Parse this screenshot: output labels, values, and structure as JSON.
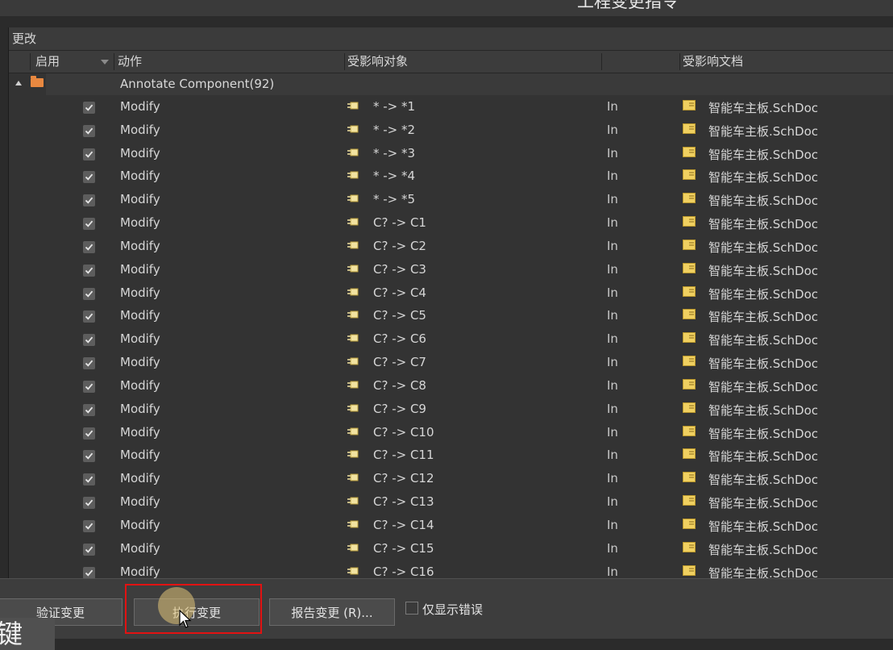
{
  "window": {
    "title": "工程变更指令"
  },
  "changes_panel": {
    "group_header": "更改",
    "columns": {
      "enable": "启用",
      "action": "动作",
      "affected_object": "受影响对象",
      "affected_document": "受影响文档"
    },
    "group": {
      "label": "Annotate Component(92)",
      "expanded": true
    },
    "rows": [
      {
        "enabled": true,
        "action": "Modify",
        "object": "* -> *1",
        "direction": "In",
        "document": "智能车主板.SchDoc"
      },
      {
        "enabled": true,
        "action": "Modify",
        "object": "* -> *2",
        "direction": "In",
        "document": "智能车主板.SchDoc"
      },
      {
        "enabled": true,
        "action": "Modify",
        "object": "* -> *3",
        "direction": "In",
        "document": "智能车主板.SchDoc"
      },
      {
        "enabled": true,
        "action": "Modify",
        "object": "* -> *4",
        "direction": "In",
        "document": "智能车主板.SchDoc"
      },
      {
        "enabled": true,
        "action": "Modify",
        "object": "* -> *5",
        "direction": "In",
        "document": "智能车主板.SchDoc"
      },
      {
        "enabled": true,
        "action": "Modify",
        "object": "C? -> C1",
        "direction": "In",
        "document": "智能车主板.SchDoc"
      },
      {
        "enabled": true,
        "action": "Modify",
        "object": "C? -> C2",
        "direction": "In",
        "document": "智能车主板.SchDoc"
      },
      {
        "enabled": true,
        "action": "Modify",
        "object": "C? -> C3",
        "direction": "In",
        "document": "智能车主板.SchDoc"
      },
      {
        "enabled": true,
        "action": "Modify",
        "object": "C? -> C4",
        "direction": "In",
        "document": "智能车主板.SchDoc"
      },
      {
        "enabled": true,
        "action": "Modify",
        "object": "C? -> C5",
        "direction": "In",
        "document": "智能车主板.SchDoc"
      },
      {
        "enabled": true,
        "action": "Modify",
        "object": "C? -> C6",
        "direction": "In",
        "document": "智能车主板.SchDoc"
      },
      {
        "enabled": true,
        "action": "Modify",
        "object": "C? -> C7",
        "direction": "In",
        "document": "智能车主板.SchDoc"
      },
      {
        "enabled": true,
        "action": "Modify",
        "object": "C? -> C8",
        "direction": "In",
        "document": "智能车主板.SchDoc"
      },
      {
        "enabled": true,
        "action": "Modify",
        "object": "C? -> C9",
        "direction": "In",
        "document": "智能车主板.SchDoc"
      },
      {
        "enabled": true,
        "action": "Modify",
        "object": "C? -> C10",
        "direction": "In",
        "document": "智能车主板.SchDoc"
      },
      {
        "enabled": true,
        "action": "Modify",
        "object": "C? -> C11",
        "direction": "In",
        "document": "智能车主板.SchDoc"
      },
      {
        "enabled": true,
        "action": "Modify",
        "object": "C? -> C12",
        "direction": "In",
        "document": "智能车主板.SchDoc"
      },
      {
        "enabled": true,
        "action": "Modify",
        "object": "C? -> C13",
        "direction": "In",
        "document": "智能车主板.SchDoc"
      },
      {
        "enabled": true,
        "action": "Modify",
        "object": "C? -> C14",
        "direction": "In",
        "document": "智能车主板.SchDoc"
      },
      {
        "enabled": true,
        "action": "Modify",
        "object": "C? -> C15",
        "direction": "In",
        "document": "智能车主板.SchDoc"
      },
      {
        "enabled": true,
        "action": "Modify",
        "object": "C? -> C16",
        "direction": "In",
        "document": "智能车主板.SchDoc"
      }
    ]
  },
  "buttons": {
    "validate": "验证变更",
    "execute": "执行变更",
    "report": "报告变更 (R)..."
  },
  "only_show_errors": {
    "label": "仅显示错误",
    "checked": false
  },
  "overlay_text": "键",
  "colors": {
    "highlight_box": "#e21212",
    "folder": "#e88840",
    "doc_icon": "#f0d060"
  },
  "icons": {
    "folder": "folder-icon",
    "object": "component-icon",
    "document": "schematic-doc-icon",
    "checkbox": "check-icon"
  }
}
